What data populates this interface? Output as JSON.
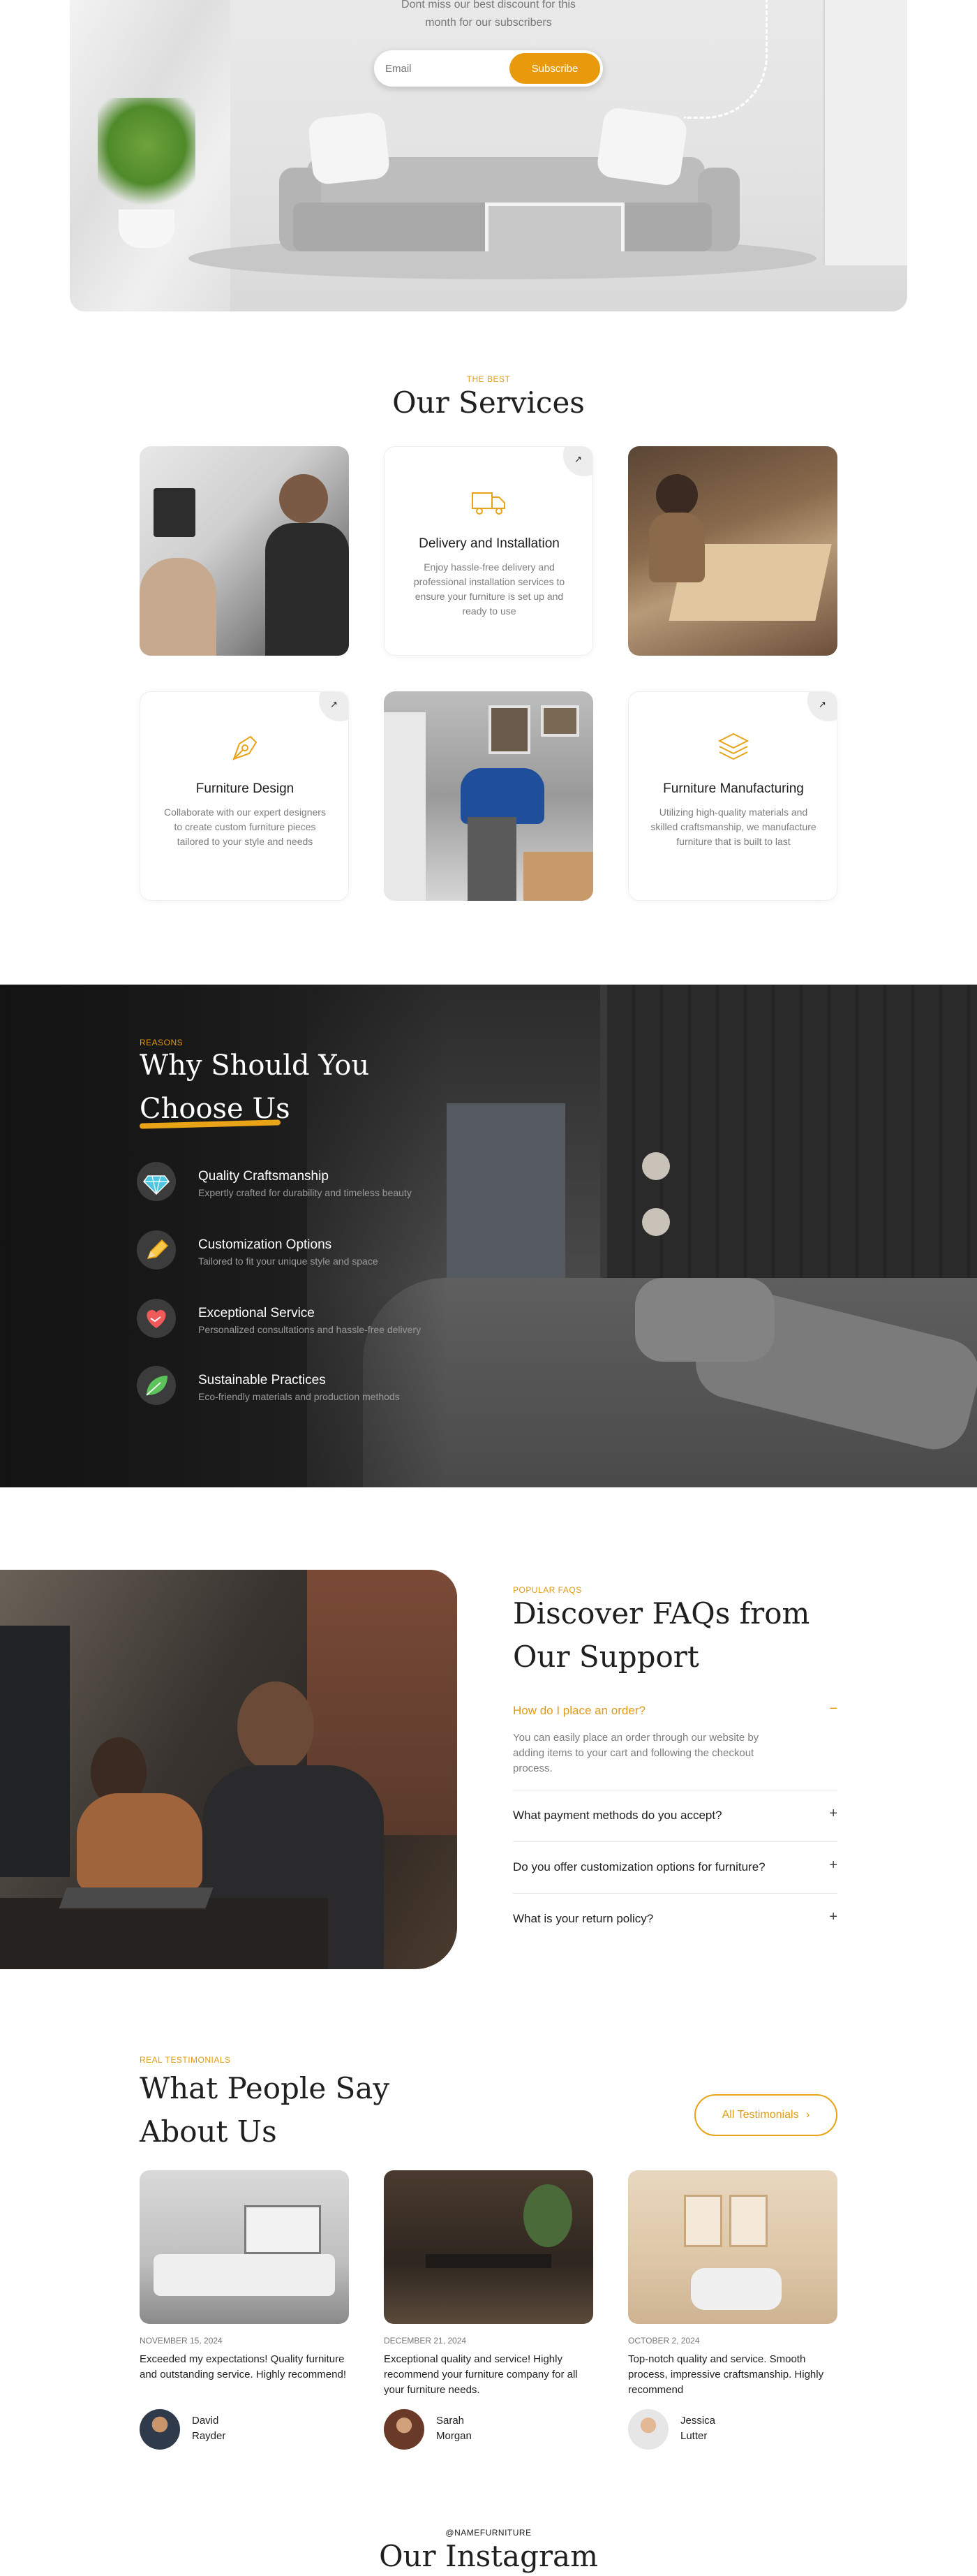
{
  "hero": {
    "subtitle_line1": "Dont miss our best discount for this",
    "subtitle_line2": "month for our subscribers",
    "email_placeholder": "Email",
    "subscribe_label": "Subscribe"
  },
  "services": {
    "eyebrow": "THE BEST",
    "title": "Our Services",
    "cards": [
      {
        "title": "Delivery and Installation",
        "desc": "Enjoy hassle-free delivery and professional installation services to ensure your furniture is set up and ready to use",
        "icon": "truck-icon",
        "arrow": "↗"
      },
      {
        "title": "Furniture Design",
        "desc": "Collaborate with our expert designers to create custom furniture pieces tailored to your style and needs",
        "icon": "pen-nib-icon",
        "arrow": "↗"
      },
      {
        "title": "Furniture Manufacturing",
        "desc": "Utilizing high-quality materials and skilled craftsmanship, we manufacture furniture that is built to last",
        "icon": "layers-icon",
        "arrow": "↗"
      }
    ]
  },
  "why": {
    "eyebrow": "REASONS",
    "title_line1": "Why Should You",
    "title_line2": "Choose Us",
    "features": [
      {
        "title": "Quality Craftsmanship",
        "desc": "Expertly crafted for durability and timeless beauty",
        "icon": "diamond-icon"
      },
      {
        "title": "Customization Options",
        "desc": "Tailored to fit your unique style and space",
        "icon": "pencil-icon"
      },
      {
        "title": "Exceptional Service",
        "desc": "Personalized consultations and hassle-free delivery",
        "icon": "heart-handshake-icon"
      },
      {
        "title": "Sustainable Practices",
        "desc": "Eco-friendly materials and production methods",
        "icon": "leaf-icon"
      }
    ]
  },
  "faq": {
    "eyebrow": "POPULAR FAQS",
    "title_line1": "Discover FAQs from",
    "title_line2": "Our Support",
    "items": [
      {
        "q": "How do I place an order?",
        "a": "You can easily place an order through our website by adding items to your cart and following the checkout process.",
        "sign": "−"
      },
      {
        "q": "What payment methods do you accept?",
        "sign": "+"
      },
      {
        "q": "Do you offer customization options for furniture?",
        "sign": "+"
      },
      {
        "q": "What is your return policy?",
        "sign": "+"
      }
    ]
  },
  "testimonials": {
    "eyebrow": "REAL TESTIMONIALS",
    "title_line1": "What People Say",
    "title_line2": "About Us",
    "all_label": "All Testimonials",
    "all_arrow": "›",
    "items": [
      {
        "date": "NOVEMBER 15, 2024",
        "quote": "Exceeded my expectations! Quality furniture and outstanding service. Highly recommend!",
        "first": "David",
        "last": "Rayder"
      },
      {
        "date": "DECEMBER 21, 2024",
        "quote": "Exceptional quality and service! Highly recommend your furniture company for all your furniture needs.",
        "first": "Sarah",
        "last": "Morgan"
      },
      {
        "date": "OCTOBER 2, 2024",
        "quote": "Top-notch quality and service. Smooth process, impressive craftsmanship. Highly recommend",
        "first": "Jessica",
        "last": "Lutter"
      }
    ]
  },
  "instagram": {
    "eyebrow": "@NAMEFURNITURE",
    "title": "Our Instagram"
  },
  "colors": {
    "accent": "#e8a317",
    "dark": "#1f1f1f",
    "muted": "#7d7d7d"
  }
}
